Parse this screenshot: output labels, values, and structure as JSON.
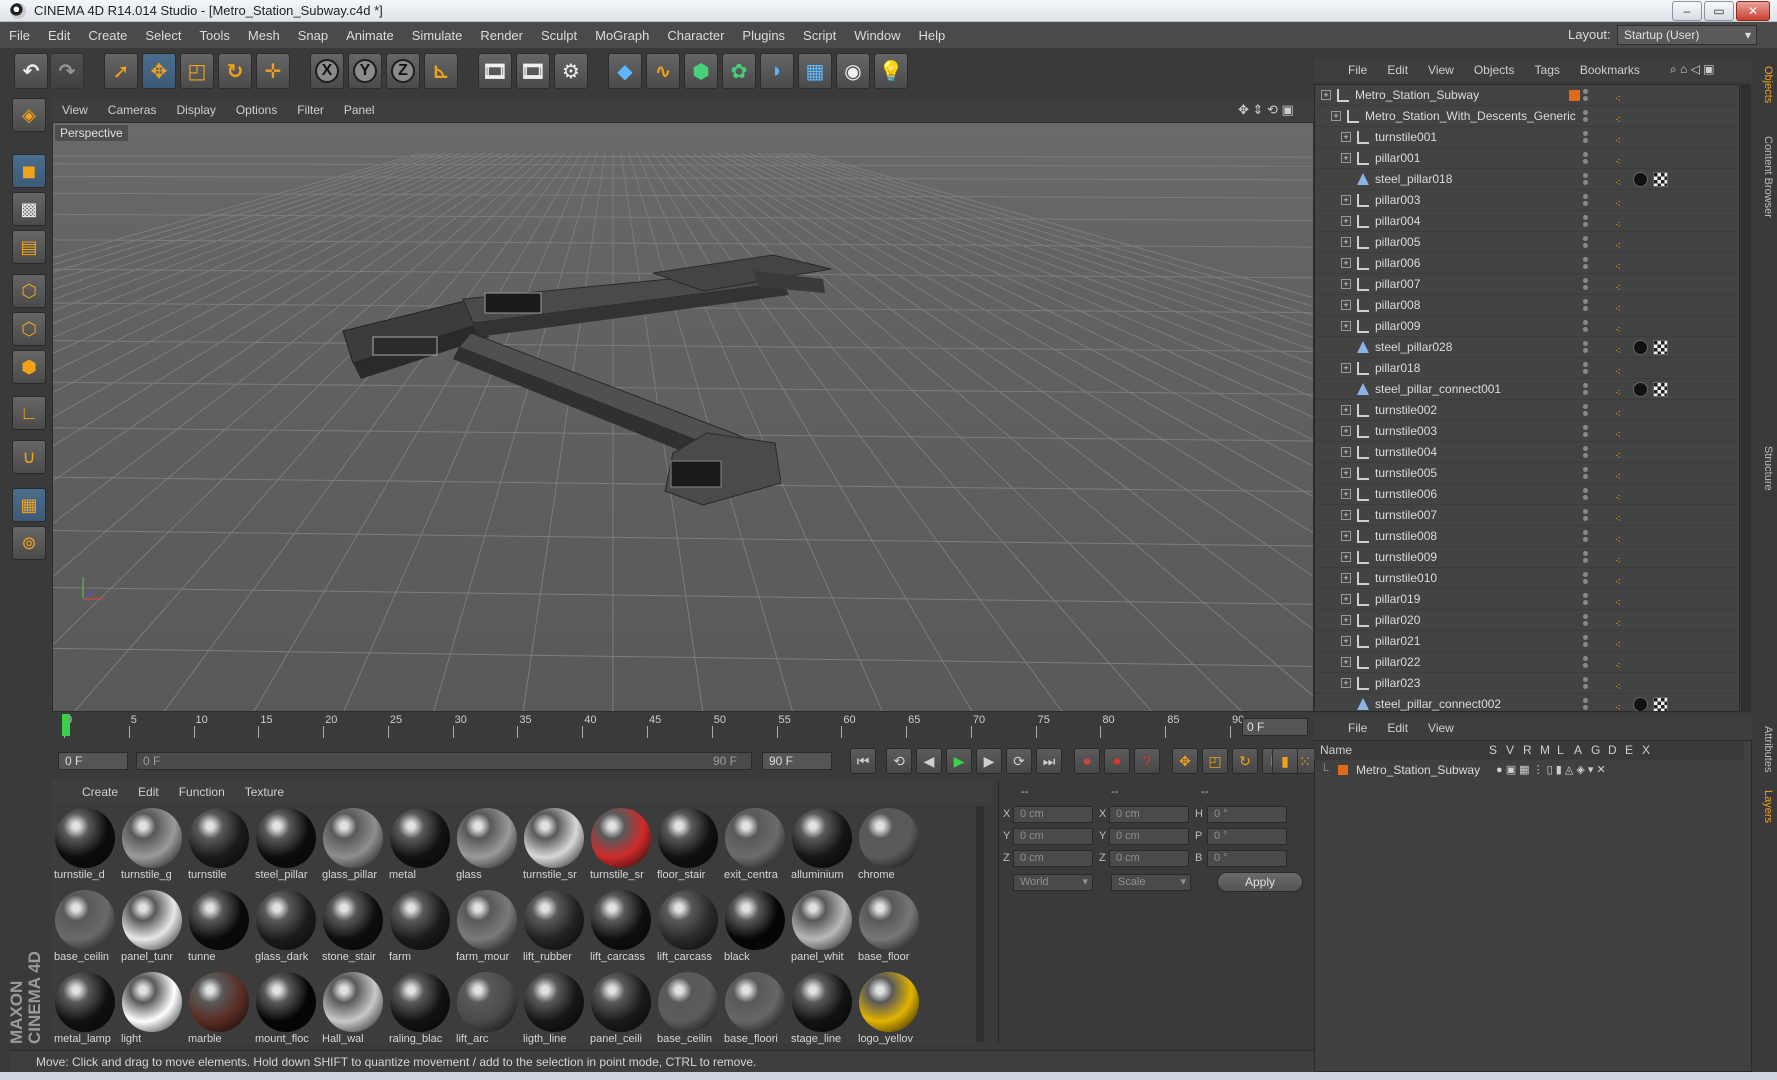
{
  "window": {
    "title": "CINEMA 4D R14.014 Studio - [Metro_Station_Subway.c4d *]",
    "btn_min": "‒",
    "btn_max": "▭",
    "btn_close": "✕"
  },
  "menubar": {
    "items": [
      "File",
      "Edit",
      "Create",
      "Select",
      "Tools",
      "Mesh",
      "Snap",
      "Animate",
      "Simulate",
      "Render",
      "Sculpt",
      "MoGraph",
      "Character",
      "Plugins",
      "Script",
      "Window",
      "Help"
    ],
    "layout_label": "Layout:",
    "layout_value": "Startup (User)"
  },
  "viewport": {
    "menu": [
      "View",
      "Cameras",
      "Display",
      "Options",
      "Filter",
      "Panel"
    ],
    "label": "Perspective"
  },
  "timeline": {
    "ticks": [
      "0",
      "5",
      "10",
      "15",
      "20",
      "25",
      "30",
      "35",
      "40",
      "45",
      "50",
      "55",
      "60",
      "65",
      "70",
      "75",
      "80",
      "85",
      "90"
    ],
    "current_frame": "0 F",
    "start_field": "0 F",
    "slider_start": "0 F",
    "slider_end": "90 F",
    "end_field": "90 F"
  },
  "material_manager": {
    "menu": [
      "Create",
      "Edit",
      "Function",
      "Texture"
    ],
    "materials": [
      {
        "name": "turnstile_d",
        "color": "#0c0c0c"
      },
      {
        "name": "turnstile_g",
        "color": "#9a9a9a"
      },
      {
        "name": "turnstile",
        "color": "#1a1a1a"
      },
      {
        "name": "steel_pillar",
        "color": "#0c0c0c"
      },
      {
        "name": "glass_pillar",
        "color": "#8e8e8e"
      },
      {
        "name": "metal",
        "color": "#111111"
      },
      {
        "name": "glass",
        "color": "#9a9a9a"
      },
      {
        "name": "turnstile_sr",
        "color": "#d8d8d8"
      },
      {
        "name": "turnstile_sr",
        "color": "#d02a2a"
      },
      {
        "name": "floor_stair",
        "color": "#101010"
      },
      {
        "name": "exit_centra",
        "color": "#6b6b6b"
      },
      {
        "name": "alluminium",
        "color": "#151515"
      },
      {
        "name": "chrome",
        "color": "#5a5a5a"
      },
      {
        "name": "base_ceilin",
        "color": "#6a6a6a"
      },
      {
        "name": "panel_tunr",
        "color": "#e8e8e8"
      },
      {
        "name": "tunne",
        "color": "#0a0a0a"
      },
      {
        "name": "glass_dark",
        "color": "#1c1c1c"
      },
      {
        "name": "stone_stair",
        "color": "#0e0e0e"
      },
      {
        "name": "farm",
        "color": "#1a1a1a"
      },
      {
        "name": "farm_mour",
        "color": "#7a7a7a"
      },
      {
        "name": "lift_rubber",
        "color": "#222222"
      },
      {
        "name": "lift_carcass",
        "color": "#0f0f0f"
      },
      {
        "name": "lift_carcass",
        "color": "#2a2a2a"
      },
      {
        "name": "black",
        "color": "#050505"
      },
      {
        "name": "panel_whit",
        "color": "#b8b8b8"
      },
      {
        "name": "base_floor",
        "color": "#777777"
      },
      {
        "name": "metal_lamp",
        "color": "#111111"
      },
      {
        "name": "light",
        "color": "#ffffff"
      },
      {
        "name": "marble",
        "color": "#5a2c22"
      },
      {
        "name": "mount_floc",
        "color": "#050505"
      },
      {
        "name": "Hall_wal",
        "color": "#c8c8c8"
      },
      {
        "name": "raling_blac",
        "color": "#121212"
      },
      {
        "name": "lift_arc",
        "color": "#4a4a4a"
      },
      {
        "name": "ligth_line",
        "color": "#161616"
      },
      {
        "name": "panel_ceili",
        "color": "#1a1a1a"
      },
      {
        "name": "base_ceilin",
        "color": "#5c5c5c"
      },
      {
        "name": "base_floori",
        "color": "#666666"
      },
      {
        "name": "stage_line",
        "color": "#121212"
      },
      {
        "name": "logo_yellov",
        "color": "#e2b400"
      }
    ]
  },
  "coordinates": {
    "header": [
      "--",
      "--",
      "--"
    ],
    "rows": [
      {
        "a_label": "X",
        "a_val": "0 cm",
        "b_label": "X",
        "b_val": "0 cm",
        "c_label": "H",
        "c_val": "0 °"
      },
      {
        "a_label": "Y",
        "a_val": "0 cm",
        "b_label": "Y",
        "b_val": "0 cm",
        "c_label": "P",
        "c_val": "0 °"
      },
      {
        "a_label": "Z",
        "a_val": "0 cm",
        "b_label": "Z",
        "b_val": "0 cm",
        "c_label": "B",
        "c_val": "0 °"
      }
    ],
    "mode": "World",
    "scale": "Scale",
    "apply": "Apply"
  },
  "status": "Move: Click and drag to move elements. Hold down SHIFT to quantize movement / add to the selection in point mode, CTRL to remove.",
  "object_manager": {
    "menu": [
      "File",
      "Edit",
      "View",
      "Objects",
      "Tags",
      "Bookmarks"
    ],
    "rows": [
      {
        "name": "Metro_Station_Subway",
        "level": 0,
        "type": "null",
        "tag": "",
        "selected_color": "#e06a1a"
      },
      {
        "name": "Metro_Station_With_Descents_Generic",
        "level": 1,
        "type": "null",
        "tag": ""
      },
      {
        "name": "turnstile001",
        "level": 2,
        "type": "null",
        "tag": ""
      },
      {
        "name": "pillar001",
        "level": 2,
        "type": "null",
        "tag": ""
      },
      {
        "name": "steel_pillar018",
        "level": 2,
        "type": "mesh",
        "tag": "mat"
      },
      {
        "name": "pillar003",
        "level": 2,
        "type": "null",
        "tag": ""
      },
      {
        "name": "pillar004",
        "level": 2,
        "type": "null",
        "tag": ""
      },
      {
        "name": "pillar005",
        "level": 2,
        "type": "null",
        "tag": ""
      },
      {
        "name": "pillar006",
        "level": 2,
        "type": "null",
        "tag": ""
      },
      {
        "name": "pillar007",
        "level": 2,
        "type": "null",
        "tag": ""
      },
      {
        "name": "pillar008",
        "level": 2,
        "type": "null",
        "tag": ""
      },
      {
        "name": "pillar009",
        "level": 2,
        "type": "null",
        "tag": ""
      },
      {
        "name": "steel_pillar028",
        "level": 2,
        "type": "mesh",
        "tag": "mat"
      },
      {
        "name": "pillar018",
        "level": 2,
        "type": "null",
        "tag": ""
      },
      {
        "name": "steel_pillar_connect001",
        "level": 2,
        "type": "mesh",
        "tag": "mat"
      },
      {
        "name": "turnstile002",
        "level": 2,
        "type": "null",
        "tag": ""
      },
      {
        "name": "turnstile003",
        "level": 2,
        "type": "null",
        "tag": ""
      },
      {
        "name": "turnstile004",
        "level": 2,
        "type": "null",
        "tag": ""
      },
      {
        "name": "turnstile005",
        "level": 2,
        "type": "null",
        "tag": ""
      },
      {
        "name": "turnstile006",
        "level": 2,
        "type": "null",
        "tag": ""
      },
      {
        "name": "turnstile007",
        "level": 2,
        "type": "null",
        "tag": ""
      },
      {
        "name": "turnstile008",
        "level": 2,
        "type": "null",
        "tag": ""
      },
      {
        "name": "turnstile009",
        "level": 2,
        "type": "null",
        "tag": ""
      },
      {
        "name": "turnstile010",
        "level": 2,
        "type": "null",
        "tag": ""
      },
      {
        "name": "pillar019",
        "level": 2,
        "type": "null",
        "tag": ""
      },
      {
        "name": "pillar020",
        "level": 2,
        "type": "null",
        "tag": ""
      },
      {
        "name": "pillar021",
        "level": 2,
        "type": "null",
        "tag": ""
      },
      {
        "name": "pillar022",
        "level": 2,
        "type": "null",
        "tag": ""
      },
      {
        "name": "pillar023",
        "level": 2,
        "type": "null",
        "tag": ""
      },
      {
        "name": "steel_pillar_connect002",
        "level": 2,
        "type": "mesh",
        "tag": "mat"
      }
    ],
    "side_tabs": [
      "Objects",
      "Content Browser",
      "Structure"
    ]
  },
  "layer_manager": {
    "menu": [
      "File",
      "Edit",
      "View"
    ],
    "columns": [
      "Name",
      "S",
      "V",
      "R",
      "M",
      "L",
      "A",
      "G",
      "D",
      "E",
      "X"
    ],
    "row": "Metro_Station_Subway",
    "side_tabs": [
      "Attributes",
      "Layers"
    ]
  }
}
